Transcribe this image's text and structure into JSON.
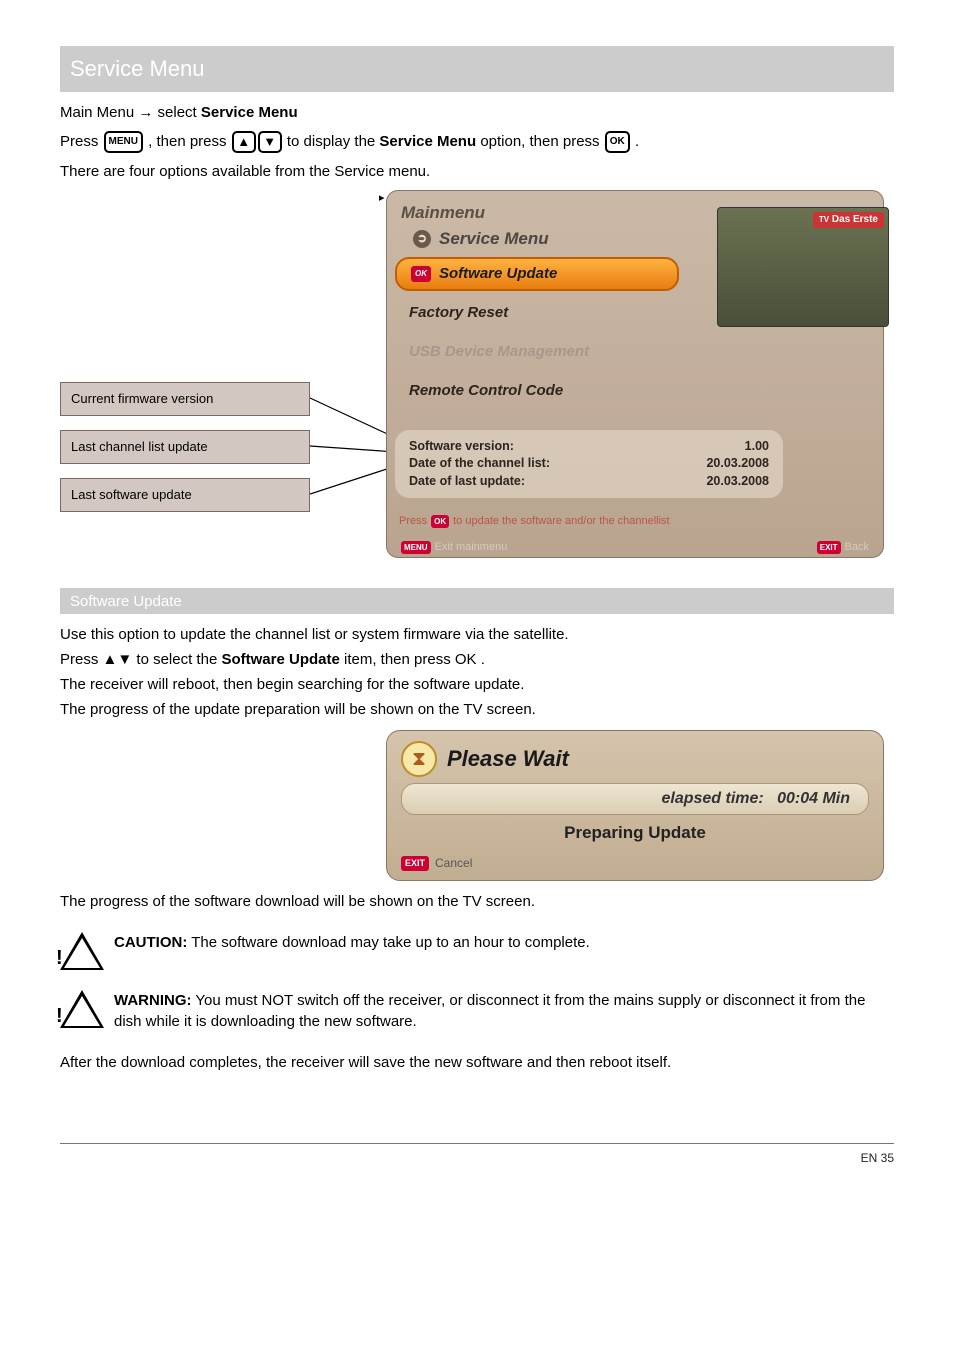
{
  "section": {
    "title": "Service Menu"
  },
  "intro": {
    "prefix": "Main Menu → select",
    "menu_name": "Service Menu",
    "line1a": "Press ",
    "line1b": ", then press ",
    "line1c": " to display the ",
    "service_menu_bold": "Service Menu",
    "line1d": " option, then press ",
    "line1e": ".",
    "note": "There are four options available from the Service menu."
  },
  "labels": {
    "l1": "Current firmware version",
    "l2": "Last channel list update",
    "l3": "Last software update"
  },
  "mainmenu_screenshot": {
    "title": "Mainmenu",
    "subtitle": "Service Menu",
    "pip_channel": "Das Erste",
    "items": {
      "software_update": "Software Update",
      "factory_reset": "Factory Reset",
      "usb_device_management": "USB Device Management",
      "remote_control_code": "Remote Control Code"
    },
    "info": {
      "sw_version_label": "Software version:",
      "sw_version_value": "1.00",
      "channel_list_label": "Date of the channel list:",
      "channel_list_value": "20.03.2008",
      "last_update_label": "Date of last update:",
      "last_update_value": "20.03.2008"
    },
    "hint_prefix": "Press",
    "hint_suffix": "to update the software and/or the channellist",
    "footer_left_btn": "MENU",
    "footer_left_text": "Exit mainmenu",
    "footer_right_btn": "EXIT",
    "footer_right_text": "Back",
    "ok_chip": "OK"
  },
  "software_update": {
    "heading": "Software Update",
    "p1a": "Use this option to update the channel list or system firmware via the satellite.",
    "p2a": "Press ",
    "p2b": " to select the ",
    "p2b_bold": "Software Update",
    "p2c": " item, then press ",
    "p2d": ".",
    "p3": "The receiver will reboot, then begin searching for the software update.",
    "p4": "The progress of the update preparation will be shown on the TV screen.",
    "p5": "The progress of the software download will be shown on the TV screen."
  },
  "please_wait": {
    "title": "Please Wait",
    "elapsed_label": "elapsed time:",
    "elapsed_value": "00:04 Min",
    "status": "Preparing Update",
    "cancel_btn": "EXIT",
    "cancel_text": "Cancel"
  },
  "warnings": {
    "w1_bold": "CAUTION:",
    "w1_text": " The software download may take up to an hour to complete.",
    "w2_bold": "WARNING:",
    "w2_text": " You must NOT switch off the receiver, or disconnect it from the mains supply or disconnect it from the dish while it is downloading the new software."
  },
  "after": {
    "p": "After the download completes, the receiver will save the new software and then reboot itself."
  },
  "footer": {
    "left": "",
    "right": "EN 35"
  },
  "keys": {
    "menu": "MENU",
    "up": "▲",
    "down": "▼",
    "ok": "OK"
  }
}
